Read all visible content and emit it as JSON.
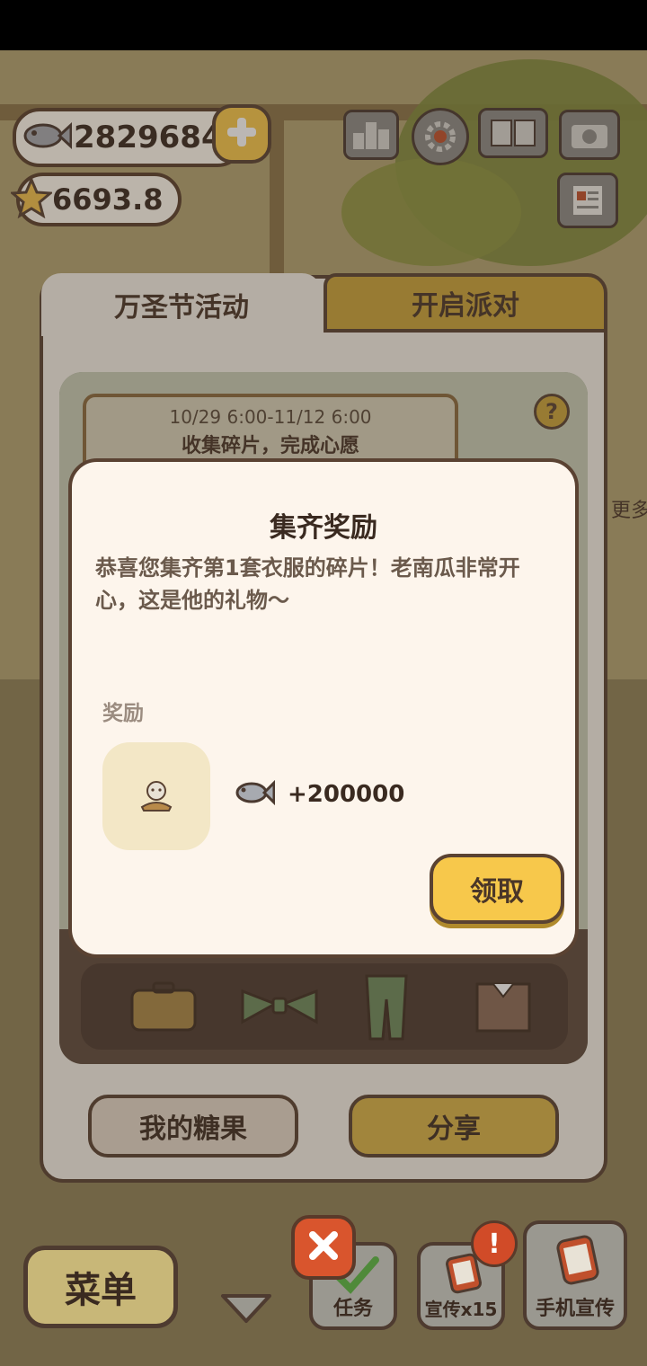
{
  "hud": {
    "fish_count": "2829684",
    "star_count": "6693.8"
  },
  "tabs": {
    "left": "万圣节活动",
    "right": "开启派对"
  },
  "event": {
    "date": "10/29 6:00-11/12 6:00",
    "subtitle": "收集碎片，完成心愿"
  },
  "side": {
    "more": "更多"
  },
  "dialog": {
    "title": "集齐奖励",
    "message": "恭喜您集齐第1套衣服的碎片！老南瓜非常开心，这是他的礼物～",
    "reward_label": "奖励",
    "reward_amount": "+200000",
    "claim_button": "领取"
  },
  "panel_buttons": {
    "my_candy": "我的糖果",
    "share": "分享"
  },
  "bottom_bar": {
    "menu": "菜单",
    "tasks": "任务",
    "promote": "宣传x15",
    "phone_promote": "手机宣传"
  },
  "colors": {
    "accent_yellow": "#f7c84b",
    "tab_gold": "#c9a43a",
    "outline_brown": "#5a4232",
    "dialog_bg": "#fdf5ec"
  }
}
